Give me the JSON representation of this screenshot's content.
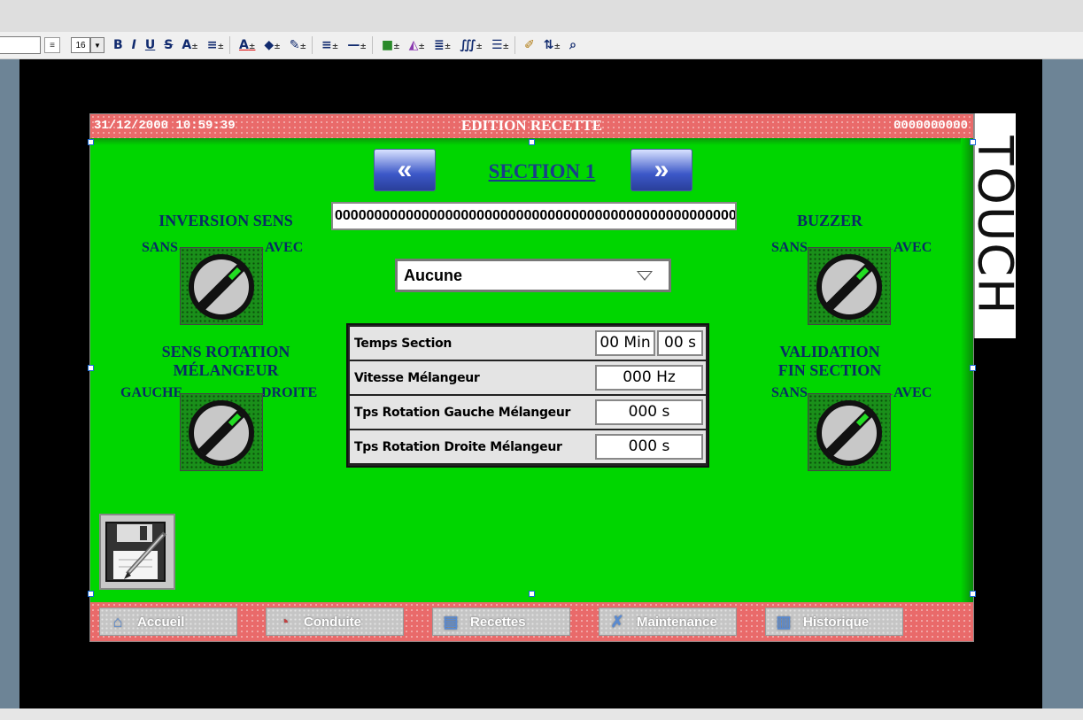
{
  "toolbar": {
    "font_size": "16",
    "tools": [
      "B",
      "I",
      "U",
      "S",
      "A",
      "≡",
      "A",
      "◆",
      "✎",
      "≡",
      "—",
      "■",
      "◭",
      "≣",
      "∭",
      "☰",
      "✐",
      "⇅",
      "⌕"
    ]
  },
  "screen": {
    "header": {
      "datetime": "31/12/2000 10:59:39",
      "title": "EDITION RECETTE",
      "counter": "0000000000"
    },
    "section": {
      "title": "SECTION 1",
      "prev_icon": "double-left-arrow-icon",
      "next_icon": "double-right-arrow-icon"
    },
    "name_field": {
      "value": "0000000000000000000000000000000000000000000000000000"
    },
    "combo": {
      "value": "Aucune"
    },
    "switches": {
      "inversion": {
        "title": "INVERSION SENS",
        "left": "SANS",
        "right": "AVEC"
      },
      "rotation": {
        "title_line1": "SENS ROTATION",
        "title_line2": "MÉLANGEUR",
        "left": "GAUCHE",
        "right": "DROITE"
      },
      "buzzer": {
        "title": "BUZZER",
        "left": "SANS",
        "right": "AVEC"
      },
      "validation": {
        "title_line1": "VALIDATION",
        "title_line2": "FIN SECTION",
        "left": "SANS",
        "right": "AVEC"
      }
    },
    "table": {
      "rows": [
        {
          "label": "Temps Section",
          "min": "00 Min",
          "sec": "00 s"
        },
        {
          "label": "Vitesse Mélangeur",
          "value": "000 Hz"
        },
        {
          "label": "Tps Rotation Gauche Mélangeur",
          "value": "000 s"
        },
        {
          "label": "Tps Rotation Droite Mélangeur",
          "value": "000 s"
        }
      ]
    },
    "footer": {
      "buttons": [
        {
          "label": "Accueil",
          "icon": "home-icon"
        },
        {
          "label": "Conduite",
          "icon": "gauge-icon"
        },
        {
          "label": "Recettes",
          "icon": "book-icon"
        },
        {
          "label": "Maintenance",
          "icon": "wrench-icon"
        },
        {
          "label": "Historique",
          "icon": "history-icon"
        }
      ]
    }
  },
  "side_label": "TOUCH",
  "colors": {
    "screen_bg": "#00d600",
    "header_bg": "#e96a6a",
    "title_blue": "#1a3c8a"
  }
}
